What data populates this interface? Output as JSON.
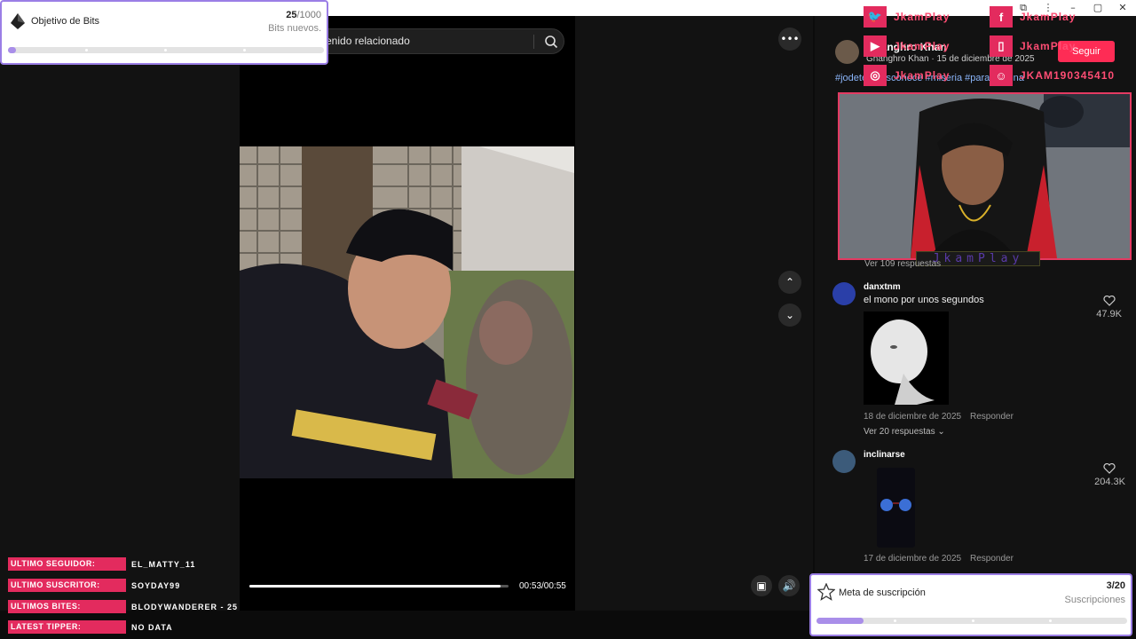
{
  "bits_goal": {
    "title": "Objetivo de Bits",
    "current": "25",
    "total": "/1000",
    "subtitle": "Bits nuevos.",
    "progress_fraction": 0.025
  },
  "search": {
    "value": "enido relacionado"
  },
  "video": {
    "time": "00:53/00:55",
    "progress_fraction": 0.97
  },
  "socials": [
    {
      "icon": "twitter-icon",
      "name": "JkamPlay"
    },
    {
      "icon": "facebook-icon",
      "name": "JkamPlay"
    },
    {
      "icon": "youtube-icon",
      "name": "JkamPlay"
    },
    {
      "icon": "twitch-icon",
      "name": "JkamPlay"
    },
    {
      "icon": "instagram-icon",
      "name": "JkamPlay"
    },
    {
      "icon": "discord-icon",
      "name": "JKAM190345410"
    }
  ],
  "post": {
    "author": "Ghanghro Khan",
    "meta": "Ghanghro Khan · 15 de diciembre de 2025",
    "follow_label": "Seguir",
    "hashtags": "#jodete #desconoce #miseria #paratipagina"
  },
  "cam": {
    "label": "JkamPlay"
  },
  "see_replies_top": "Ver 109 respuestas",
  "comments": [
    {
      "user": "danxtnm",
      "text": "el mono por unos segundos",
      "date": "18 de diciembre de 2025",
      "reply": "Responder",
      "likes": "47.9K",
      "more": "Ver 20 respuestas"
    },
    {
      "user": "inclinarse",
      "text": "",
      "date": "17 de diciembre de 2025",
      "reply": "Responder",
      "likes": "204.3K",
      "more": ""
    }
  ],
  "sub_goal": {
    "title": "Meta de suscripción",
    "count": "3/20",
    "label": "Suscripciones",
    "progress_fraction": 0.15
  },
  "stream_labels": [
    {
      "key": "ULTIMO SEGUIDOR:",
      "value": "EL_MATTY_11"
    },
    {
      "key": "ULTIMO SUSCRITOR:",
      "value": "SOYDAY99"
    },
    {
      "key": "ULTIMOS BITES:",
      "value": "BLODYWANDERER - 25"
    },
    {
      "key": "LATEST TIPPER:",
      "value": "NO DATA"
    }
  ],
  "colors": {
    "accent_pink": "#e32b5e",
    "goal_purple": "#a98ee9",
    "follow_red": "#fe2c55"
  }
}
